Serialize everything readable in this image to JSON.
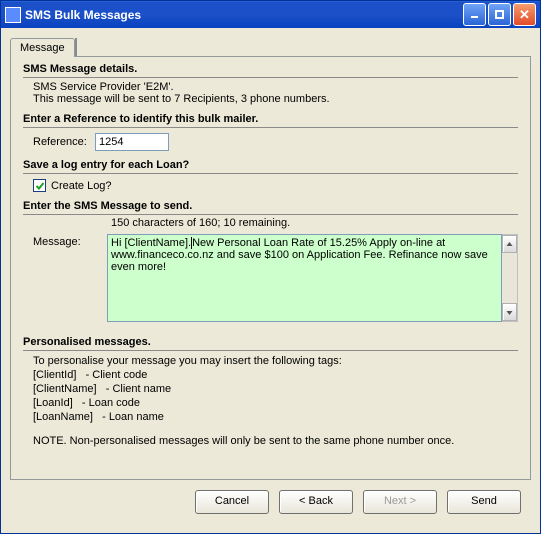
{
  "window": {
    "title": "SMS Bulk Messages"
  },
  "tab": {
    "message": "Message"
  },
  "details": {
    "heading": "SMS Message details.",
    "provider": "SMS Service Provider 'E2M'.",
    "recipients": "This message will be sent to 7 Recipients, 3 phone numbers."
  },
  "reference": {
    "heading": "Enter a Reference to identify this bulk mailer.",
    "label": "Reference:",
    "value": "1254"
  },
  "log": {
    "heading": "Save a log entry for each Loan?",
    "label": "Create Log?",
    "checked": true
  },
  "message": {
    "heading": "Enter the SMS Message to send.",
    "charcount": "150 characters of 160; 10 remaining.",
    "label": "Message:",
    "text_before_caret": "Hi [ClientName].",
    "text_after_caret": "New Personal Loan Rate of 15.25%  Apply on-line at www.financeco.co.nz and save $100 on Application Fee. Refinance now save even more!"
  },
  "personalised": {
    "heading": "Personalised messages.",
    "intro": "To personalise your message you may insert the following tags:",
    "tag1": "[ClientId]   - Client code",
    "tag2": "[ClientName]   - Client name",
    "tag3": "[LoanId]   - Loan code",
    "tag4": "[LoanName]   - Loan name",
    "note": "NOTE. Non-personalised messages will only be sent to the same phone number once."
  },
  "buttons": {
    "cancel": "Cancel",
    "back": "< Back",
    "next": "Next >",
    "send": "Send"
  }
}
